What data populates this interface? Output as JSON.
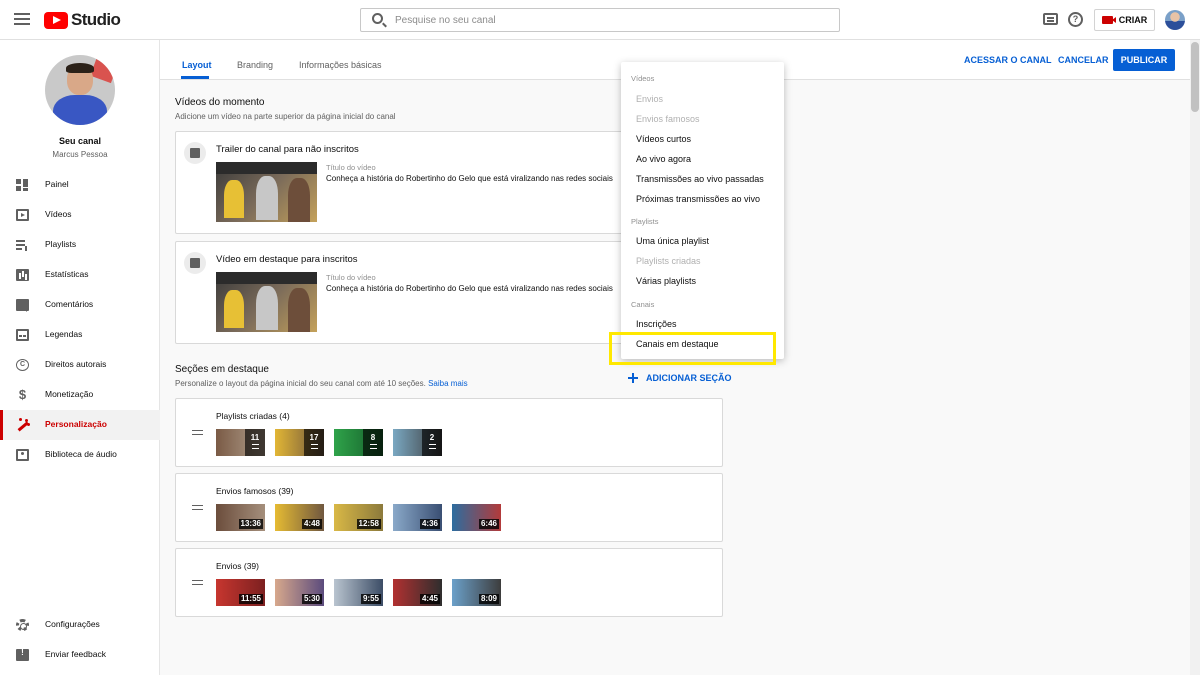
{
  "topbar": {
    "logo_text": "Studio",
    "search_placeholder": "Pesquise no seu canal",
    "create_label": "CRIAR"
  },
  "sidebar": {
    "channel_name": "Seu canal",
    "channel_user": "Marcus Pessoa",
    "items": [
      {
        "label": "Painel",
        "icon": "dashboard-icon"
      },
      {
        "label": "Vídeos",
        "icon": "video-icon"
      },
      {
        "label": "Playlists",
        "icon": "playlist-icon"
      },
      {
        "label": "Estatísticas",
        "icon": "analytics-icon"
      },
      {
        "label": "Comentários",
        "icon": "comments-icon"
      },
      {
        "label": "Legendas",
        "icon": "subtitles-icon"
      },
      {
        "label": "Direitos autorais",
        "icon": "copyright-icon"
      },
      {
        "label": "Monetização",
        "icon": "dollar-icon"
      },
      {
        "label": "Personalização",
        "icon": "magic-wand-icon",
        "active": true
      },
      {
        "label": "Biblioteca de áudio",
        "icon": "audio-library-icon"
      }
    ],
    "bottom_items": [
      {
        "label": "Configurações",
        "icon": "gear-icon"
      },
      {
        "label": "Enviar feedback",
        "icon": "feedback-icon"
      }
    ]
  },
  "tabs": [
    "Layout",
    "Branding",
    "Informações básicas"
  ],
  "actions": {
    "view_channel": "ACESSAR O CANAL",
    "cancel": "CANCELAR",
    "publish": "PUBLICAR"
  },
  "spotlight": {
    "title": "Vídeos do momento",
    "subtitle": "Adicione um vídeo na parte superior da página inicial do canal",
    "cards": [
      {
        "title": "Trailer do canal para não inscritos",
        "video_label": "Título do vídeo",
        "video_title": "Conheça a história do Robertinho do Gelo que está viralizando nas redes sociais"
      },
      {
        "title": "Vídeo em destaque para inscritos",
        "video_label": "Título do vídeo",
        "video_title": "Conheça a história do Robertinho do Gelo que está viralizando nas redes sociais"
      }
    ]
  },
  "featured": {
    "title": "Seções em destaque",
    "subtitle": "Personalize o layout da página inicial do seu canal com até 10 seções.",
    "learn_more": "Saiba mais",
    "add_section": "ADICIONAR SEÇÃO",
    "sections": [
      {
        "name": "Playlists criadas (4)",
        "badges": [
          "11",
          "17",
          "8",
          "2"
        ]
      },
      {
        "name": "Envios famosos (39)",
        "durations": [
          "13:36",
          "4:48",
          "12:58",
          "4:36",
          "6:46"
        ]
      },
      {
        "name": "Envios (39)",
        "durations": [
          "11:55",
          "5:30",
          "9:55",
          "4:45",
          "8:09"
        ]
      }
    ]
  },
  "menu": {
    "groups": [
      {
        "label": "Vídeos",
        "items": [
          {
            "label": "Envios",
            "disabled": true
          },
          {
            "label": "Envios famosos",
            "disabled": true
          },
          {
            "label": "Vídeos curtos",
            "disabled": false
          },
          {
            "label": "Ao vivo agora",
            "disabled": false
          },
          {
            "label": "Transmissões ao vivo passadas",
            "disabled": false
          },
          {
            "label": "Próximas transmissões ao vivo",
            "disabled": false
          }
        ]
      },
      {
        "label": "Playlists",
        "items": [
          {
            "label": "Uma única playlist",
            "disabled": false
          },
          {
            "label": "Playlists criadas",
            "disabled": true
          },
          {
            "label": "Várias playlists",
            "disabled": false
          }
        ]
      },
      {
        "label": "Canais",
        "items": [
          {
            "label": "Inscrições",
            "disabled": false
          },
          {
            "label": "Canais em destaque",
            "disabled": false
          }
        ]
      }
    ]
  },
  "colors": {
    "accent": "#065fd4",
    "brand_red": "#ff0000",
    "highlight": "#ffe800"
  }
}
